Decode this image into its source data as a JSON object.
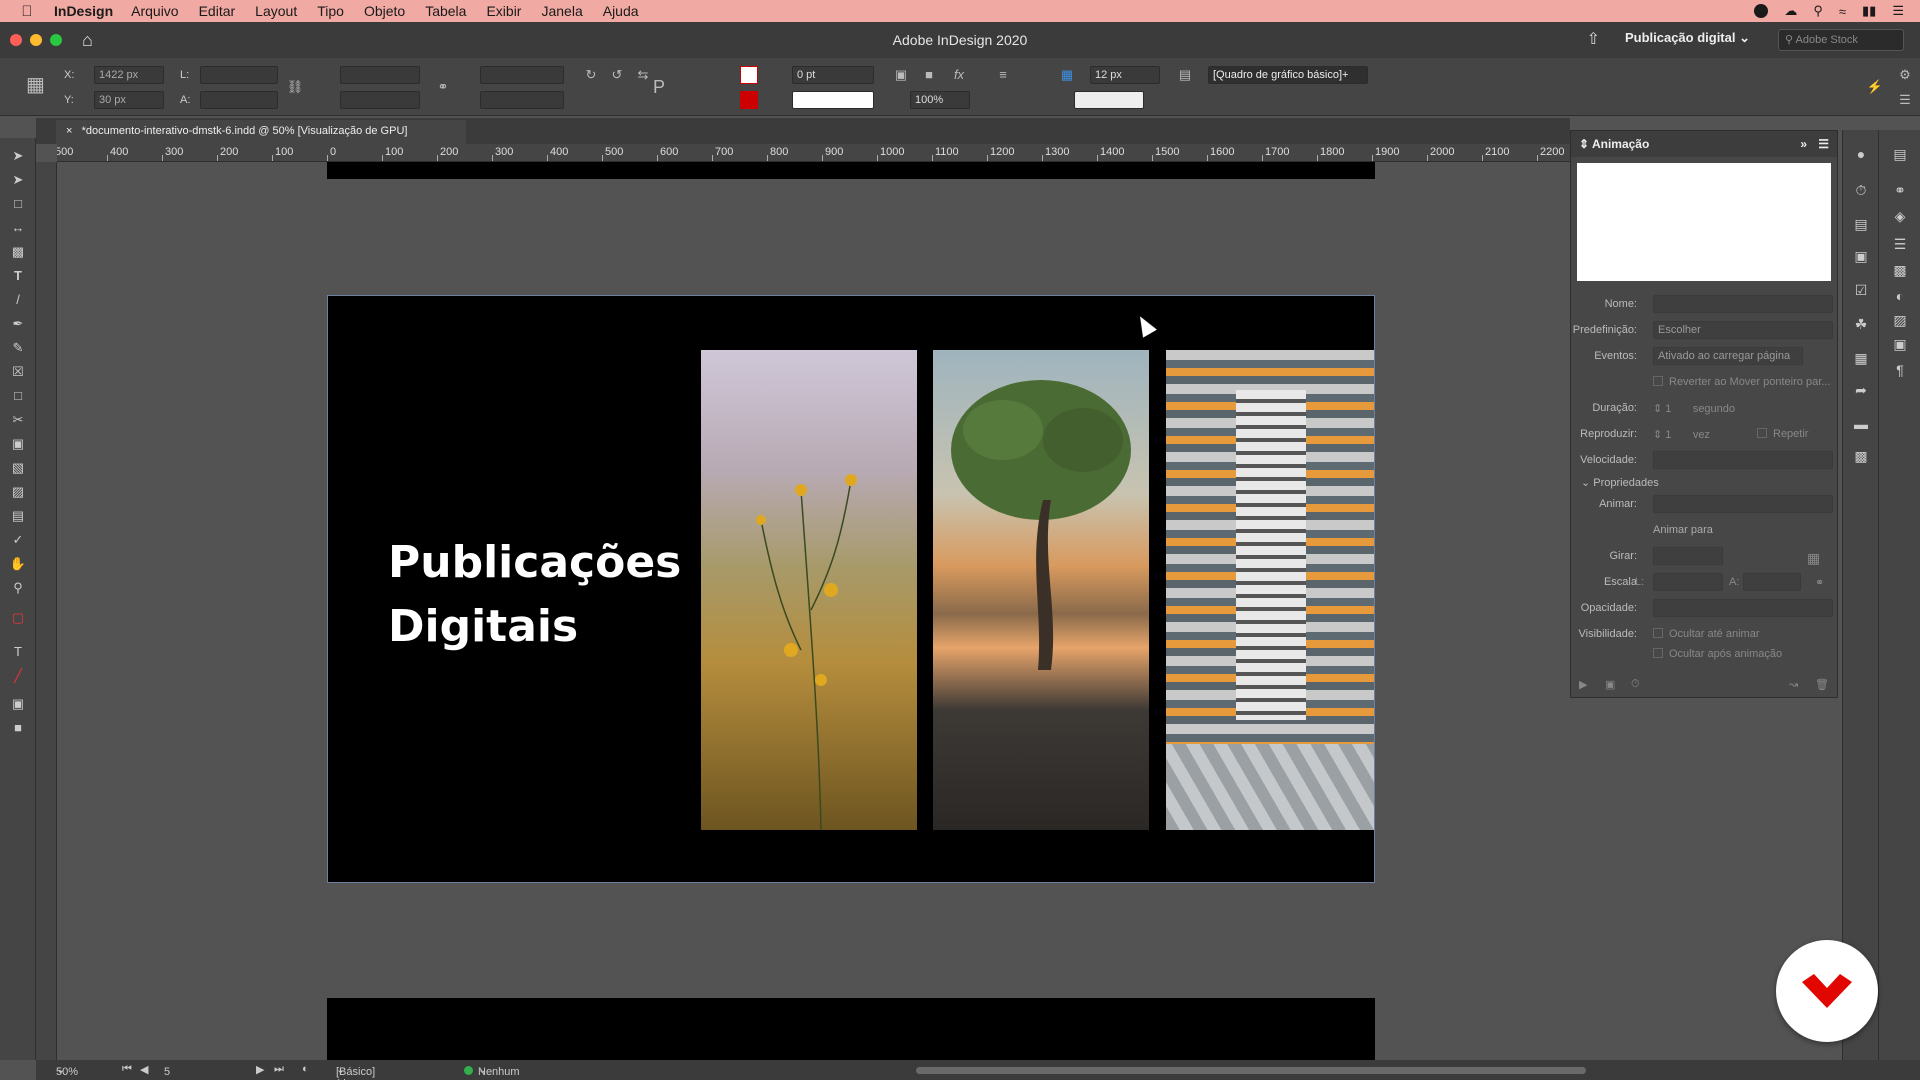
{
  "menubar": {
    "app_name": "InDesign",
    "items": [
      "Arquivo",
      "Editar",
      "Layout",
      "Tipo",
      "Objeto",
      "Tabela",
      "Exibir",
      "Janela",
      "Ajuda"
    ]
  },
  "titlebar": {
    "title": "Adobe InDesign 2020",
    "workspace": "Publicação digital",
    "stock_placeholder": "Adobe Stock"
  },
  "control": {
    "x_label": "X:",
    "x_value": "1422 px",
    "y_label": "Y:",
    "y_value": "30 px",
    "w_label": "L:",
    "h_label": "A:",
    "stroke_weight": "0 pt",
    "scale_percent": "100%",
    "spacing": "12 px",
    "object_style": "[Quadro de gráfico básico]+"
  },
  "document": {
    "tab_title": "*documento-interativo-dmstk-6.indd @ 50% [Visualização de GPU]",
    "headline_line1": "Publicações",
    "headline_line2": "Digitais"
  },
  "ruler": {
    "labels": [
      "500",
      "400",
      "300",
      "200",
      "100",
      "0",
      "100",
      "200",
      "300",
      "400",
      "500",
      "600",
      "700",
      "800",
      "900",
      "1000",
      "1100",
      "1200",
      "1300",
      "1400",
      "1500",
      "1600",
      "1700",
      "1800",
      "1900",
      "2000",
      "2100",
      "2200"
    ]
  },
  "animation_panel": {
    "title": "Animação",
    "name_label": "Nome:",
    "preset_label": "Predefinição:",
    "preset_value": "Escolher",
    "events_label": "Eventos:",
    "events_value": "Ativado ao carregar página",
    "reverse_label": "Reverter ao Mover ponteiro par...",
    "duration_label": "Duração:",
    "duration_value": "1",
    "duration_unit": "segundo",
    "play_label": "Reproduzir:",
    "play_value": "1",
    "play_unit": "vez",
    "loop_label": "Repetir",
    "speed_label": "Velocidade:",
    "properties_label": "Propriedades",
    "animate_label": "Animar:",
    "animate_to_label": "Animar para",
    "rotate_label": "Girar:",
    "scale_label": "Escala",
    "scale_w_label": "L:",
    "scale_h_label": "A:",
    "opacity_label": "Opacidade:",
    "visibility_label": "Visibilidade:",
    "hide_until_label": "Ocultar até animar",
    "hide_after_label": "Ocultar após animação"
  },
  "statusbar": {
    "zoom": "50%",
    "page": "5",
    "profile": "[Básico] (de traba...",
    "errors": "Nenhum erro"
  },
  "colors": {
    "menubar_bg": "#f1a9a3",
    "page_bg": "#000000",
    "badge_accent": "#e10600",
    "no_error": "#31b04d"
  }
}
